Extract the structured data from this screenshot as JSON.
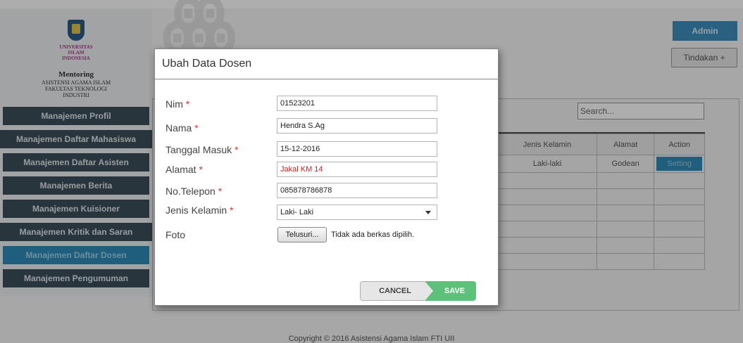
{
  "sidebar": {
    "logo": {
      "university": [
        "UNIVERSITAS",
        "ISLAM",
        "INDONESIA"
      ],
      "title": "Mentoring",
      "subtitle": [
        "ASISTENSI AGAMA ISLAM",
        "FAKULTAS TEKNOLOGI",
        "INDUSTRI"
      ]
    },
    "items": [
      {
        "label": "Manajemen Profil"
      },
      {
        "label": "Manajemen Daftar Mahasiswa"
      },
      {
        "label": "Manajemen Daftar Asisten"
      },
      {
        "label": "Manajemen Berita"
      },
      {
        "label": "Manajemen Kuisioner"
      },
      {
        "label": "Manajemen Kritik dan Saran"
      },
      {
        "label": "Manajemen Daftar Dosen"
      },
      {
        "label": "Manajemen Pengumuman"
      }
    ],
    "active_index": 6
  },
  "header": {
    "admin_label": "Admin",
    "action_label": "Tindakan +"
  },
  "table": {
    "search_placeholder": "Search...",
    "columns": [
      "Jenis Kelamin",
      "Alamat",
      "Action"
    ],
    "rows": [
      [
        "Laki-laki",
        "Godean",
        "Setting"
      ]
    ]
  },
  "modal": {
    "title": "Ubah Data Dosen",
    "fields": [
      {
        "label": "Nim",
        "required": "*",
        "value": "01523201"
      },
      {
        "label": "Nama",
        "required": "*",
        "value": "Hendra S.Ag"
      },
      {
        "label": "Tanggal Masuk",
        "required": "*",
        "value": "15-12-2016"
      },
      {
        "label": "Alamat",
        "required": "*",
        "value": "Jakal KM 14"
      },
      {
        "label": "No.Telepon",
        "required": "*",
        "value": "085878786878"
      },
      {
        "label": "Jenis Kelamin",
        "required": "*",
        "value": "Laki- Laki"
      },
      {
        "label": "Foto",
        "required": "",
        "value": ""
      }
    ],
    "file_button": "Telusuri...",
    "file_status": "Tidak ada berkas dipilih.",
    "cancel_label": "CANCEL",
    "save_label": "SAVE"
  },
  "footer": {
    "text": "Copyright © 2016 Asistensi Agama Islam FTI UII"
  },
  "colors": {
    "sidebar_item": "#3d4f5a",
    "active_item": "#2e8cb8",
    "save_button": "#5dc17a",
    "required_mark": "#dd3333"
  }
}
